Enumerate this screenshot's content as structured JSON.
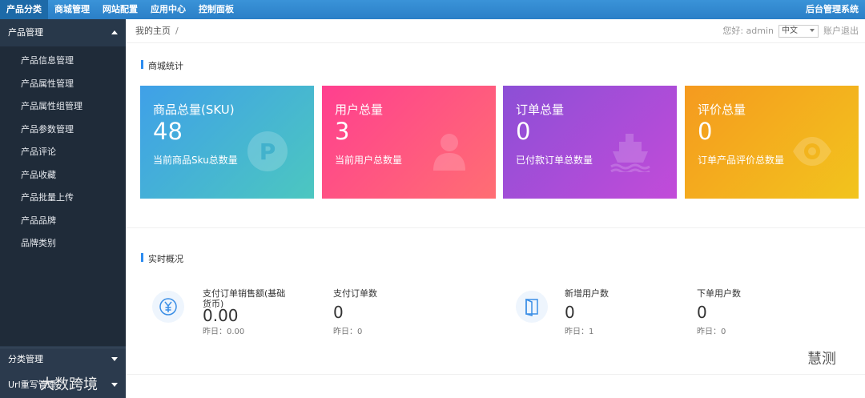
{
  "topbar": {
    "nav": [
      "产品分类",
      "商城管理",
      "网站配置",
      "应用中心",
      "控制面板"
    ],
    "brand": "后台管理系统"
  },
  "sidebar": {
    "group_title": "产品管理",
    "items": [
      "产品信息管理",
      "产品属性管理",
      "产品属性组管理",
      "产品参数管理",
      "产品评论",
      "产品收藏",
      "产品批量上传",
      "产品品牌",
      "品牌类别"
    ],
    "group2": "分类管理",
    "group3": "Url重写管理"
  },
  "header": {
    "breadcrumb": "我的主页",
    "breadcrumb_sep": "/",
    "greeting": "您好: admin",
    "language": "中文",
    "logout": "账户退出"
  },
  "stats_section": {
    "title": "商城统计"
  },
  "cards": [
    {
      "title": "商品总量(SKU)",
      "value": "48",
      "sub": "当前商品Sku总数量",
      "icon": "parking-icon",
      "color_from": "#3fa0e8",
      "color_to": "#4cc7c0"
    },
    {
      "title": "用户总量",
      "value": "3",
      "sub": "当前用户总数量",
      "icon": "user-icon",
      "color_from": "#ff3f8f",
      "color_to": "#ff6e73"
    },
    {
      "title": "订单总量",
      "value": "0",
      "sub": "已付款订单总数量",
      "icon": "ship-icon",
      "color_from": "#8c4fd6",
      "color_to": "#c24bd9"
    },
    {
      "title": "评价总量",
      "value": "0",
      "sub": "订单产品评价总数量",
      "icon": "eye-icon",
      "color_from": "#f59a1f",
      "color_to": "#f2c41d"
    }
  ],
  "realtime": {
    "title": "实时概况",
    "items": [
      {
        "label": "支付订单销售额(基础货币)",
        "value": "0.00",
        "prev": "昨日：0.00"
      },
      {
        "label": "支付订单数",
        "value": "0",
        "prev": "昨日：0"
      },
      {
        "label": "新增用户数",
        "value": "0",
        "prev": "昨日：1"
      },
      {
        "label": "下单用户数",
        "value": "0",
        "prev": "昨日：0"
      }
    ]
  },
  "watermarks": {
    "left": "大数跨境",
    "right": "慧测"
  },
  "colors": {
    "accent": "#2d8cf0",
    "sidebar": "#2b3a4d",
    "sidebar_list": "#1f2b39"
  }
}
